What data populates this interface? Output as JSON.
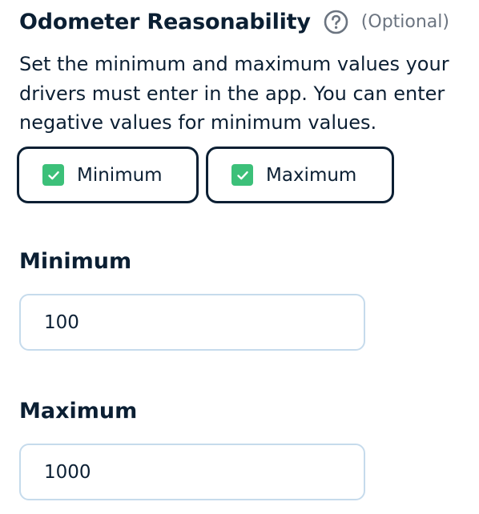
{
  "section": {
    "title": "Odometer Reasonability",
    "help_icon": "question-circle-icon",
    "optional_label": "(Optional)",
    "description": "Set the minimum and maximum values your drivers must enter in the app. You can enter negative values for minimum values."
  },
  "toggles": {
    "minimum": {
      "label": "Minimum",
      "checked": true,
      "icon": "checkmark-icon"
    },
    "maximum": {
      "label": "Maximum",
      "checked": true,
      "icon": "checkmark-icon"
    }
  },
  "fields": {
    "minimum": {
      "label": "Minimum",
      "value": "100"
    },
    "maximum": {
      "label": "Maximum",
      "value": "1000"
    }
  },
  "colors": {
    "text": "#0b1f33",
    "muted": "#6b7480",
    "checkbox": "#3cc079",
    "input_border": "#c6dbec"
  }
}
